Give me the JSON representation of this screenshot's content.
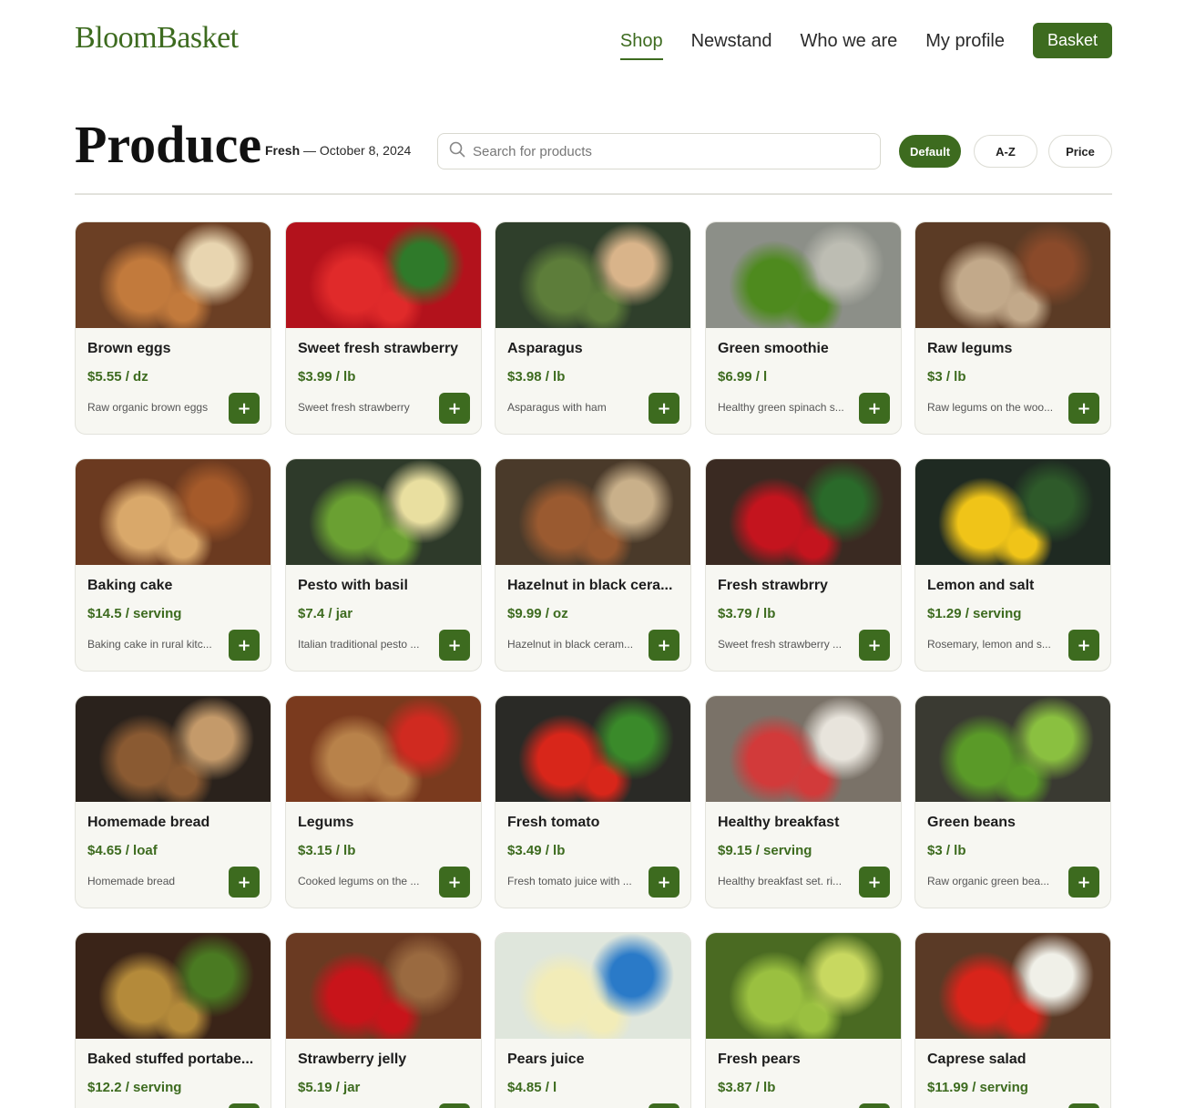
{
  "header": {
    "brand": "BloomBasket",
    "nav": [
      {
        "label": "Shop",
        "active": true
      },
      {
        "label": "Newstand",
        "active": false
      },
      {
        "label": "Who we are",
        "active": false
      },
      {
        "label": "My profile",
        "active": false
      }
    ],
    "basket_label": "Basket"
  },
  "page": {
    "title": "Produce",
    "fresh_label": "Fresh",
    "fresh_date": " — October 8, 2024",
    "search_placeholder": "Search for products",
    "sort_options": [
      {
        "label": "Default",
        "active": true
      },
      {
        "label": "A-Z",
        "active": false
      },
      {
        "label": "Price",
        "active": false
      }
    ]
  },
  "colors": {
    "accent": "#3d6b1f",
    "card_bg": "#f7f7f2"
  },
  "add_label": "+",
  "products": [
    {
      "name": "Brown eggs",
      "price": "$5.55 / dz",
      "desc": "Raw organic brown eggs",
      "img": [
        "#6b3f24",
        "#c27a3c",
        "#e8d5b0"
      ]
    },
    {
      "name": "Sweet fresh strawberry",
      "price": "$3.99 / lb",
      "desc": "Sweet fresh strawberry",
      "img": [
        "#b3121c",
        "#e02a2a",
        "#2f7a2a"
      ]
    },
    {
      "name": "Asparagus",
      "price": "$3.98 / lb",
      "desc": "Asparagus with ham",
      "img": [
        "#2f3f2b",
        "#5d7d3a",
        "#d9b48a"
      ]
    },
    {
      "name": "Green smoothie",
      "price": "$6.99 / l",
      "desc": "Healthy green spinach s...",
      "img": [
        "#8c8f88",
        "#4e8a1e",
        "#bdbdb3"
      ]
    },
    {
      "name": "Raw legums",
      "price": "$3 / lb",
      "desc": "Raw legums on the woo...",
      "img": [
        "#5b3b25",
        "#c2a98a",
        "#8a4a2a"
      ]
    },
    {
      "name": "Baking cake",
      "price": "$14.5 / serving",
      "desc": "Baking cake in rural kitc...",
      "img": [
        "#6b3a20",
        "#d9a86a",
        "#a55a2a"
      ]
    },
    {
      "name": "Pesto with basil",
      "price": "$7.4 / jar",
      "desc": "Italian traditional pesto ...",
      "img": [
        "#2e3a2a",
        "#6aa032",
        "#e9dfa0"
      ]
    },
    {
      "name": "Hazelnut in black cera...",
      "price": "$9.99 / oz",
      "desc": "Hazelnut in black ceram...",
      "img": [
        "#4a3a2a",
        "#9a5a30",
        "#c9b08a"
      ]
    },
    {
      "name": "Fresh strawbrry",
      "price": "$3.79 / lb",
      "desc": "Sweet fresh strawberry ...",
      "img": [
        "#3a2a22",
        "#c4141e",
        "#2a6a2a"
      ]
    },
    {
      "name": "Lemon and salt",
      "price": "$1.29 / serving",
      "desc": "Rosemary, lemon and s...",
      "img": [
        "#1f2a22",
        "#f0c418",
        "#2e5a2a"
      ]
    },
    {
      "name": "Homemade bread",
      "price": "$4.65 / loaf",
      "desc": "Homemade bread",
      "img": [
        "#2a221c",
        "#8a5a32",
        "#c49a6a"
      ]
    },
    {
      "name": "Legums",
      "price": "$3.15 / lb",
      "desc": "Cooked legums on the ...",
      "img": [
        "#7a3a1e",
        "#b8824a",
        "#d02a20"
      ]
    },
    {
      "name": "Fresh tomato",
      "price": "$3.49 / lb",
      "desc": "Fresh tomato juice with ...",
      "img": [
        "#2a2a26",
        "#d8261a",
        "#3a8a2a"
      ]
    },
    {
      "name": "Healthy breakfast",
      "price": "$9.15 / serving",
      "desc": "Healthy breakfast set. ri...",
      "img": [
        "#7a7268",
        "#d23a3a",
        "#e8e4dc"
      ]
    },
    {
      "name": "Green beans",
      "price": "$3 / lb",
      "desc": "Raw organic green bea...",
      "img": [
        "#3a3a32",
        "#5a9a28",
        "#8ac040"
      ]
    },
    {
      "name": "Baked stuffed portabe...",
      "price": "$12.2 / serving",
      "desc": "",
      "img": [
        "#3a2418",
        "#b48a3a",
        "#4a7a22"
      ]
    },
    {
      "name": "Strawberry jelly",
      "price": "$5.19 / jar",
      "desc": "",
      "img": [
        "#6a3a22",
        "#c8141a",
        "#9a6a40"
      ]
    },
    {
      "name": "Pears juice",
      "price": "$4.85 / l",
      "desc": "",
      "img": [
        "#dfe6dc",
        "#f2ecb8",
        "#2a7ac8"
      ]
    },
    {
      "name": "Fresh pears",
      "price": "$3.87 / lb",
      "desc": "",
      "img": [
        "#4a6a22",
        "#9ac040",
        "#c8d860"
      ]
    },
    {
      "name": "Caprese salad",
      "price": "$11.99 / serving",
      "desc": "",
      "img": [
        "#5a3a26",
        "#d8241a",
        "#f0f0e8"
      ]
    }
  ]
}
